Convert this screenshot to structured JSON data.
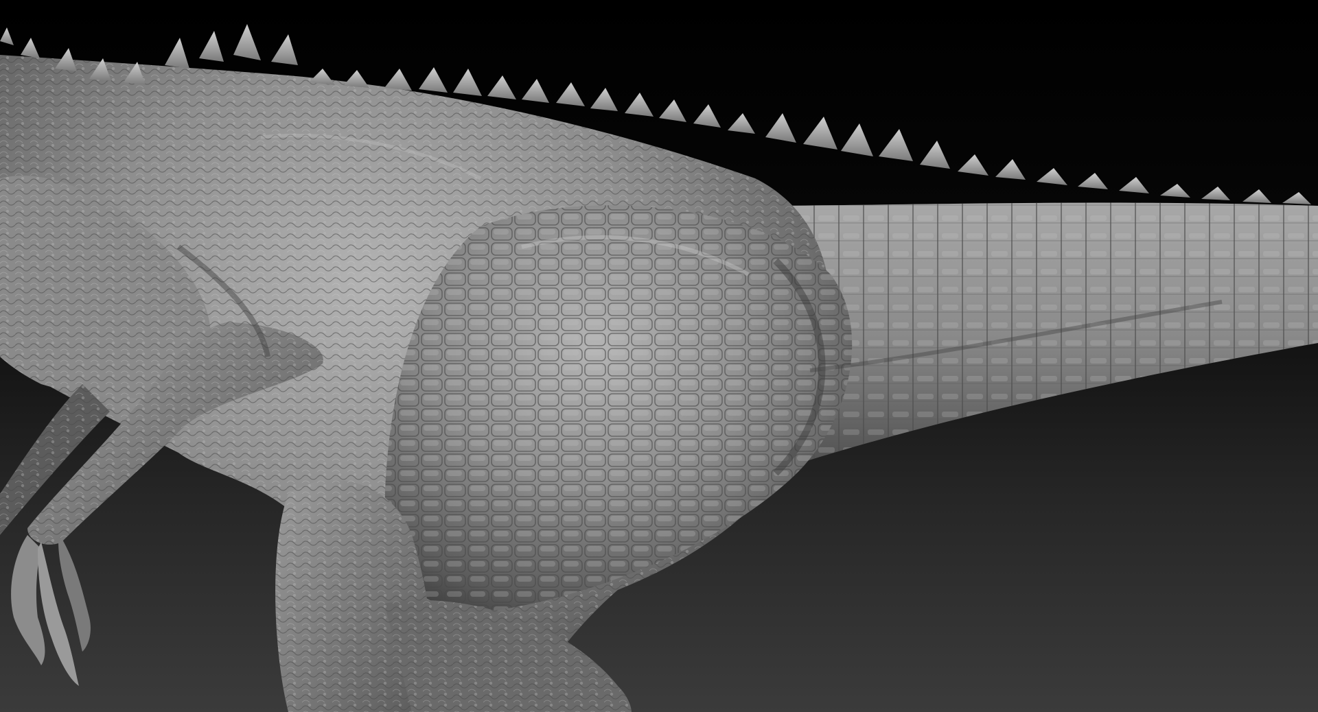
{
  "scene": {
    "subject": "sculpted-dinosaur-model",
    "material": "matcap-gray-clay",
    "background_gradient": [
      "#000000",
      "#0b0b0b",
      "#2a2a2a",
      "#3a3a3a"
    ],
    "model_colors": {
      "shadow": "#3a3a3a",
      "mid": "#7c7c7c",
      "light": "#a9a9a9",
      "highlight": "#c9c9c9"
    }
  }
}
